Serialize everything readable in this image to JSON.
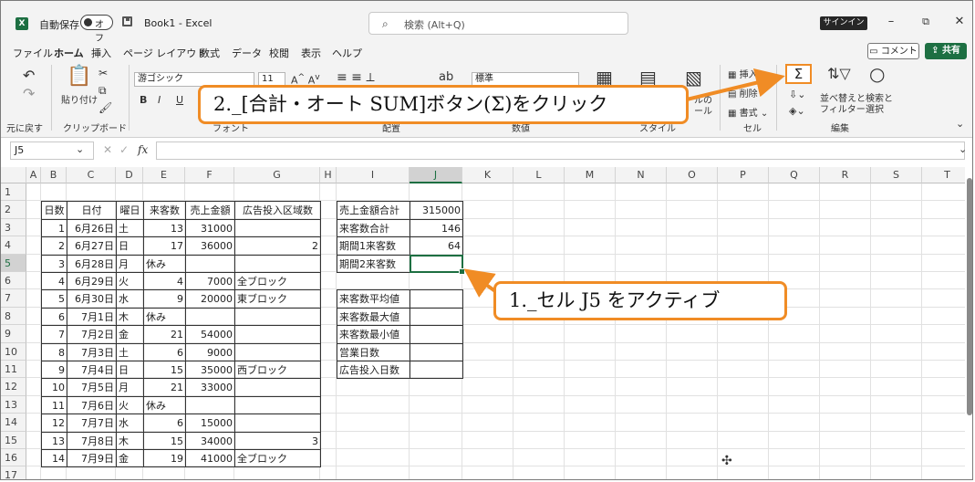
{
  "titlebar": {
    "autosave_label": "自動保存",
    "toggle_label": "オフ",
    "doc_title": "Book1 - Excel",
    "search_placeholder": "検索 (Alt+Q)",
    "signin_label": "サインイン"
  },
  "menu": {
    "items": [
      "ファイル",
      "ホーム",
      "挿入",
      "ページ レイアウト",
      "数式",
      "データ",
      "校閲",
      "表示",
      "ヘルプ"
    ],
    "comment_label": "コメント",
    "share_label": "共有"
  },
  "ribbon": {
    "undo_label": "元に戻す",
    "paste_label": "貼り付け",
    "clipboard_label": "クリップボード",
    "font_name": "游ゴシック",
    "font_size": "11",
    "font_group": "フォント",
    "align_group": "配置",
    "number_format": "標準",
    "number_group": "数値",
    "cond_format": "ルの",
    "cond_format2": "ール",
    "style_group": "スタイル",
    "insert_label": "挿入",
    "delete_label": "削除",
    "format_label": "書式",
    "cells_group": "セル",
    "sigma": "Σ",
    "sort_label": "並べ替えと",
    "filter_label": "フィルター",
    "find_label": "検索と",
    "select_label": "選択",
    "edit_group": "編集"
  },
  "formula_bar": {
    "name_box": "J5",
    "fx": "fx",
    "value": ""
  },
  "columns": [
    "A",
    "B",
    "C",
    "D",
    "E",
    "F",
    "G",
    "H",
    "I",
    "J",
    "K",
    "L",
    "M",
    "N",
    "O",
    "P",
    "Q",
    "R",
    "S",
    "T"
  ],
  "rows": [
    "1",
    "2",
    "3",
    "4",
    "5",
    "6",
    "7",
    "8",
    "9",
    "10",
    "11",
    "12",
    "13",
    "14",
    "15",
    "16",
    "17"
  ],
  "table": {
    "headers": [
      "日数",
      "日付",
      "曜日",
      "来客数",
      "売上金額",
      "広告投入区域数"
    ],
    "rows": [
      [
        "1",
        "6月26日",
        "土",
        "13",
        "31000",
        ""
      ],
      [
        "2",
        "6月27日",
        "日",
        "17",
        "36000",
        "2"
      ],
      [
        "3",
        "6月28日",
        "月",
        "休み",
        "",
        ""
      ],
      [
        "4",
        "6月29日",
        "火",
        "4",
        "7000",
        "全ブロック"
      ],
      [
        "5",
        "6月30日",
        "水",
        "9",
        "20000",
        "東ブロック"
      ],
      [
        "6",
        "7月1日",
        "木",
        "休み",
        "",
        ""
      ],
      [
        "7",
        "7月2日",
        "金",
        "21",
        "54000",
        ""
      ],
      [
        "8",
        "7月3日",
        "土",
        "6",
        "9000",
        ""
      ],
      [
        "9",
        "7月4日",
        "日",
        "15",
        "35000",
        "西ブロック"
      ],
      [
        "10",
        "7月5日",
        "月",
        "21",
        "33000",
        ""
      ],
      [
        "11",
        "7月6日",
        "火",
        "休み",
        "",
        ""
      ],
      [
        "12",
        "7月7日",
        "水",
        "6",
        "15000",
        ""
      ],
      [
        "13",
        "7月8日",
        "木",
        "15",
        "34000",
        "3"
      ],
      [
        "14",
        "7月9日",
        "金",
        "19",
        "41000",
        "全ブロック"
      ]
    ]
  },
  "summary": {
    "block1": [
      {
        "label": "売上金額合計",
        "value": "315000"
      },
      {
        "label": "来客数合計",
        "value": "146"
      },
      {
        "label": "期間1来客数",
        "value": "64"
      },
      {
        "label": "期間2来客数",
        "value": ""
      }
    ],
    "block2": [
      {
        "label": "来客数平均値",
        "value": ""
      },
      {
        "label": "来客数最大値",
        "value": ""
      },
      {
        "label": "来客数最小値",
        "value": ""
      }
    ],
    "block3": [
      {
        "label": "営業日数",
        "value": ""
      },
      {
        "label": "広告投入日数",
        "value": ""
      }
    ]
  },
  "callouts": {
    "step1": "1._セル J5 をアクティブ",
    "step2": "2._[合計・オート SUM]ボタン(Σ)をクリック"
  },
  "colors": {
    "excel_green": "#1d6f42",
    "callout_orange": "#f08c25"
  }
}
